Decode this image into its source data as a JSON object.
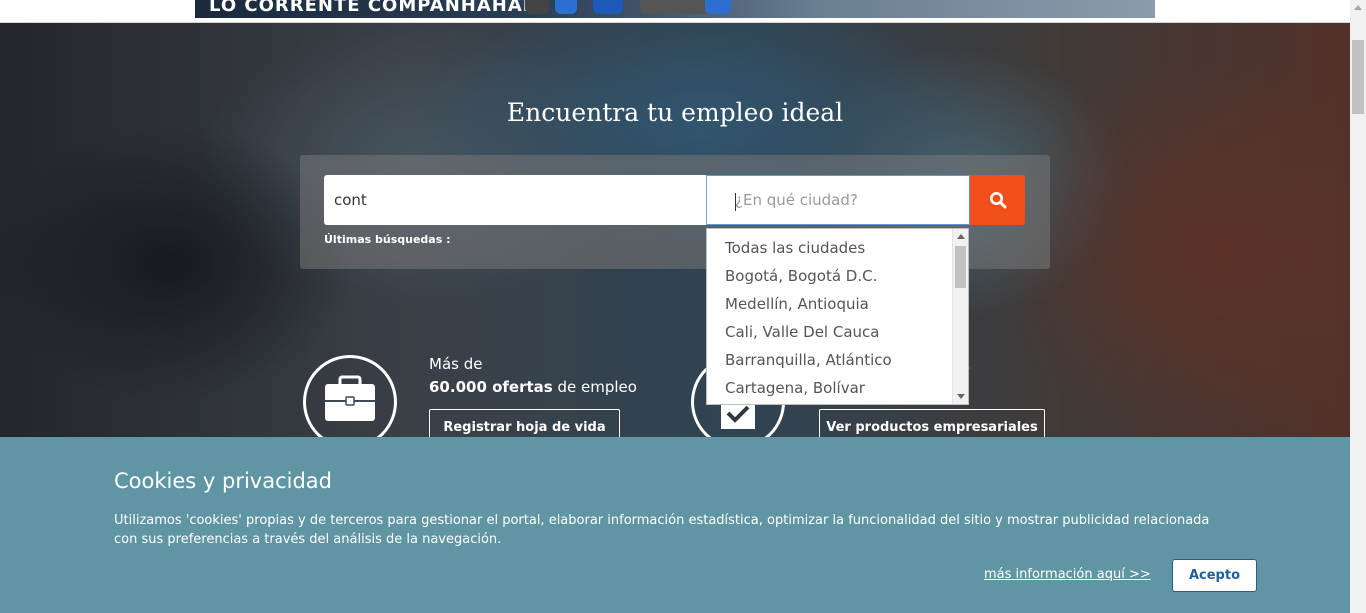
{
  "ad": {
    "banner_text": "LO CORRENTE COMPANHAHAF",
    "colors": {
      "accent": "#2c6fd1"
    }
  },
  "hero": {
    "title": "Encuentra tu empleo ideal"
  },
  "search": {
    "keyword_value": "cont",
    "city_placeholder": "¿En qué ciudad?",
    "last_searches_label": "Últimas búsquedas :",
    "button_icon": "search-icon",
    "button_color": "#f04e1a"
  },
  "city_dropdown": {
    "options": [
      "Todas las ciudades",
      "Bogotá, Bogotá D.C.",
      "Medellín, Antioquia",
      "Cali, Valle Del Cauca",
      "Barranquilla, Atlántico",
      "Cartagena, Bolívar"
    ]
  },
  "features": {
    "candidates": {
      "icon": "briefcase-icon",
      "line1": "Más de",
      "count": "60.000 ofertas",
      "count_suffix": " de empleo",
      "button": "Registrar hoja de vida"
    },
    "companies": {
      "icon": "checkbox-icon",
      "trailing_text": ".",
      "button": "Ver productos empresariales"
    }
  },
  "cookies": {
    "title": "Cookies y privacidad",
    "text": "Utilizamos 'cookies' propias y de terceros para gestionar el portal, elaborar información estadística, optimizar la funcionalidad del sitio y mostrar publicidad relacionada con sus preferencias a través del análisis de la navegación.",
    "more_link": "más información aquí >>",
    "accept_button": "Acepto",
    "background": "#6095a3"
  }
}
